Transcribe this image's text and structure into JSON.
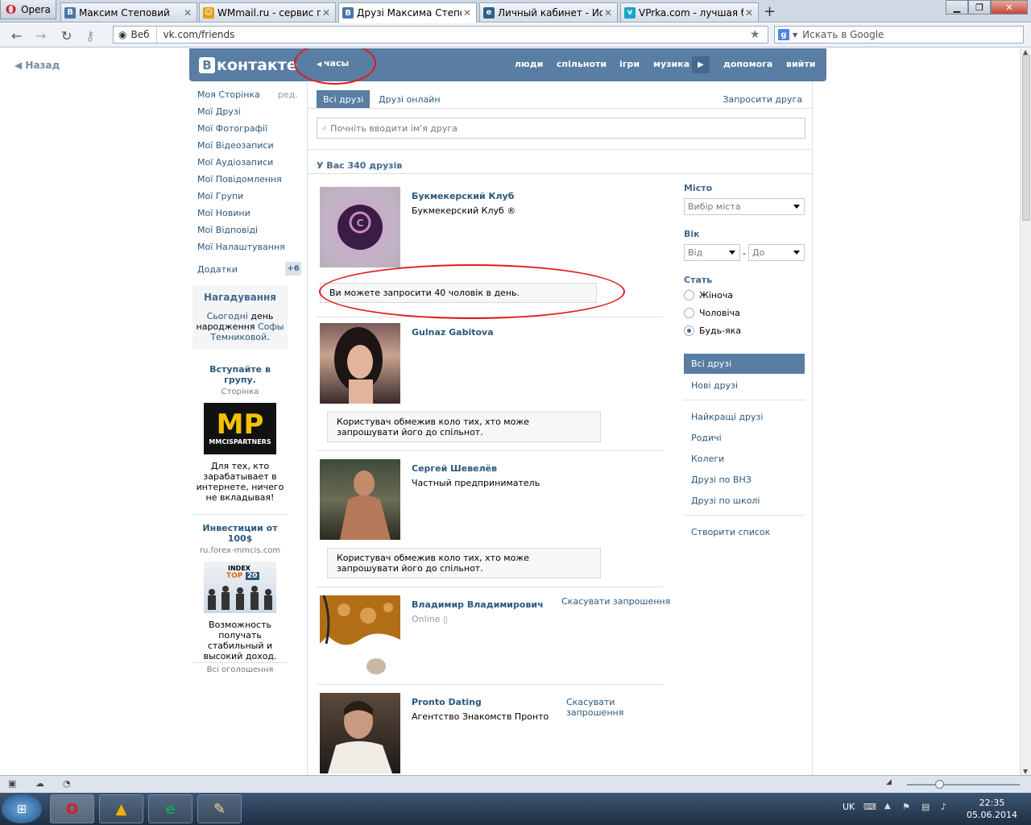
{
  "browser": {
    "menu_label": "Opera",
    "tabs": [
      {
        "title": "Максим Степовий",
        "favicon": "В",
        "color": "#4a76a8"
      },
      {
        "title": "WMmail.ru - сервис п...",
        "favicon": "☺",
        "color": "#e89b1a"
      },
      {
        "title": "Друзі Максима Степо...",
        "favicon": "В",
        "color": "#4a76a8"
      },
      {
        "title": "Личный кабинет - Ис...",
        "favicon": "e",
        "color": "#2e5e8c"
      },
      {
        "title": "VPrka.com - лучшая б...",
        "favicon": "v",
        "color": "#1aa3c9"
      }
    ],
    "url": "vk.com/friends",
    "url_prefix": "Веб",
    "search_placeholder": "Искать в Google"
  },
  "page": {
    "back": "Назад",
    "logo_text": "контакте",
    "logo_letter": "В",
    "clock_label": "часы",
    "nav": [
      "люди",
      "спільноти",
      "ігри",
      "музика",
      "допомога",
      "вийти"
    ],
    "left_menu": [
      "Моя Сторінка",
      "Мої Друзі",
      "Мої Фотографії",
      "Мої Відеозаписи",
      "Мої Аудіозаписи",
      "Мої Повідомлення",
      "Мої Групи",
      "Мої Новини",
      "Мої Відповіді",
      "Мої Налаштування"
    ],
    "edit_label": "ред.",
    "addons_label": "Додатки",
    "addons_count": "+6",
    "reminder": {
      "title": "Нагадування",
      "text1": "Сьогодні",
      "text2": " день народження ",
      "name": "Софы Темниковой",
      "dot": "."
    },
    "ad1": {
      "title": "Вступайте в групу.",
      "sub": "Сторінка",
      "img_big": "MP",
      "img_small": "MMCISPARTNERS",
      "desc": "Для тех, кто зарабатывает в интернете, ничего не вкладывая!"
    },
    "ad2": {
      "title": "Инвестиции от 100$",
      "sub": "ru.forex-mmcis.com",
      "img_text1": "INDEX",
      "img_text2": "TOP",
      "img_text3": "20",
      "desc": "Возможность получать стабильный и высокий доход."
    },
    "all_ads": "Всі оголошення",
    "tabs": {
      "all": "Всі друзі",
      "online": "Друзі онлайн",
      "invite": "Запросити друга"
    },
    "search_placeholder": "Почніть вводити ім'я друга",
    "count_label": "У Вас 340 друзів",
    "friends": [
      {
        "name": "Букмекерский Клуб",
        "sub": "Букмекерский Клуб ®",
        "note": "Ви можете запросити 40 чоловік в день.",
        "cancel": ""
      },
      {
        "name": "Gulnaz Gabitova",
        "sub": "",
        "note": "Користувач обмежив коло тих, хто може запрошувати його до спільнот.",
        "cancel": ""
      },
      {
        "name": "Сергей Шевелёв",
        "sub": "Частный предприниматель",
        "note": "Користувач обмежив коло тих, хто може запрошувати його до спільнот.",
        "cancel": ""
      },
      {
        "name": "Владимир Владимирович",
        "sub": "Online",
        "note": "",
        "cancel": "Скасувати запрошення"
      },
      {
        "name": "Pronto Dating",
        "sub": "Агентство Знакомств Пронто",
        "note": "",
        "cancel": "Скасувати запрошення"
      }
    ],
    "filters": {
      "city_label": "Місто",
      "city_value": "Вибір міста",
      "age_label": "Вік",
      "age_from": "Від",
      "age_sep": "-",
      "age_to": "До",
      "sex_label": "Стать",
      "sex_options": [
        "Жіноча",
        "Чоловіча",
        "Будь-яка"
      ],
      "sex_selected": "Будь-яка",
      "nav1": [
        "Всі друзі",
        "Нові друзі"
      ],
      "nav2": [
        "Найкращі друзі",
        "Родичі",
        "Колеги",
        "Друзі по ВНЗ",
        "Друзі по школі"
      ],
      "create": "Створити список"
    }
  },
  "taskbar": {
    "lang": "UK",
    "time": "22:35",
    "date": "05.06.2014"
  }
}
